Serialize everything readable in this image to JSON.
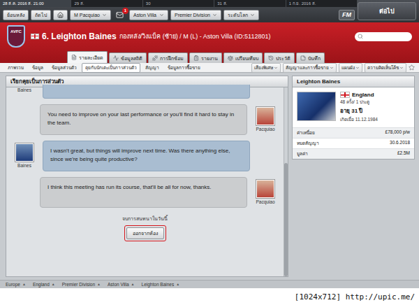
{
  "top_bar": {
    "dates": [
      {
        "label": "28 ส.ค. 2016 ส. 21:00",
        "selected": true
      },
      {
        "label": "29 ส.",
        "selected": false
      },
      {
        "label": "30",
        "selected": false
      },
      {
        "label": "31 ส.",
        "selected": false
      },
      {
        "label": "1 ก.ย. 2016 ส.",
        "selected": false
      }
    ],
    "continue_button": "ต่อไป"
  },
  "nav": {
    "back": "ย้อนหลัง",
    "forward": "ถัดไป",
    "manager": "M Pacquiao",
    "inbox_count": "1",
    "club": "Aston Villa",
    "league": "Premier Division",
    "world": "ระดับโลก",
    "logo": "FM"
  },
  "header": {
    "club_badge": "AVFC",
    "title": "6. Leighton Baines",
    "subtitle": "กองหลัง/วิงแบ็ค (ซ้าย) / M (L) - Aston Villa (ID:5112801)"
  },
  "tabs": [
    {
      "label": "รายละเอียด",
      "selected": true
    },
    {
      "label": "ข้อมูลสถิติ",
      "selected": false
    },
    {
      "label": "การฝึกซ้อม",
      "selected": false
    },
    {
      "label": "รายงาน",
      "selected": false
    },
    {
      "label": "เปรียบเทียบ",
      "selected": false
    },
    {
      "label": "ประวัติ",
      "selected": false
    },
    {
      "label": "บันทึก",
      "selected": false
    }
  ],
  "subtabs": [
    {
      "label": "ภาพรวม",
      "selected": false
    },
    {
      "label": "ข้อมูล",
      "selected": false
    },
    {
      "label": "ข้อมูลส่วนตัว",
      "selected": false
    },
    {
      "label": "คุยกับนักเตะเป็นการส่วนตัว",
      "selected": true
    },
    {
      "label": "สัญญา",
      "selected": false
    },
    {
      "label": "ข้อมูลการซื้อขาย",
      "selected": false
    }
  ],
  "subtab_menus": [
    "เสียงพิเศษ",
    "สัญญาและการซื้อขาย",
    "แผนผัง",
    "ความคิดเห็นโค้ช"
  ],
  "chat": {
    "title": "เรียกคุยเป็นการส่วนตัว",
    "messages": [
      {
        "speaker": "Baines",
        "kind": "player",
        "cut": true,
        "text": ""
      },
      {
        "speaker": "Pacquiao",
        "kind": "manager",
        "cut": false,
        "text": "You need to improve on your last performance or you'll find it hard to stay in the team."
      },
      {
        "speaker": "Baines",
        "kind": "player",
        "cut": false,
        "text": "I wasn't great, but things will improve next time. Was there anything else, since we're being quite productive?"
      },
      {
        "speaker": "Pacquiao",
        "kind": "manager",
        "cut": false,
        "text": "I think this meeting has run its course, that'll be all for now, thanks."
      }
    ],
    "end_note": "จบการสนทนาในวันนี้",
    "leave_button": {
      "label": "ออกจากห้อง",
      "highlighted": true
    }
  },
  "player_card": {
    "name": "Leighton Baines",
    "nation": "England",
    "caps": "48 ครั้ง/ 1 ประตู",
    "age": "อายุ 31 ปี",
    "born": "เกิดเมื่อ 11.12.1984",
    "details": [
      {
        "label": "ค่าเหนื่อย",
        "value": "£78,000 p/w"
      },
      {
        "label": "หมดสัญญา",
        "value": "30.6.2018"
      },
      {
        "label": "มูลค่า",
        "value": "£2.5M"
      }
    ]
  },
  "breadcrumb": {
    "items": [
      "Europe",
      "England",
      "Premier Division",
      "Aston Villa",
      "Leighton Baines"
    ],
    "arrow": "▲"
  },
  "footer": "[1024x712] http://upic.me/"
}
